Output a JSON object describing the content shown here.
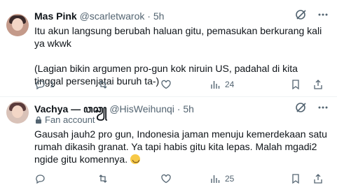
{
  "tweets": [
    {
      "name": "Mas Pink",
      "handle": "@scarletwarok",
      "separator": "·",
      "time": "5h",
      "paragraphs": [
        "Itu akun langsung berubah haluan gitu, pemasukan berkurang kali ya wkwk",
        "(Lagian bikin argumen pro-gun kok niruin US, padahal di kita tinggal persenjatai buruh ta-)"
      ],
      "reply_count": "1",
      "views": "24"
    },
    {
      "name": "Vachya — ꦮꦕꦾ",
      "handle": "@HisWeihunqi",
      "separator": "·",
      "time": "5h",
      "badge": "Fan account",
      "paragraphs": [
        "Gausah jauh2 pro gun, Indonesia jaman menuju kemerdekaan satu rumah dikasih granat. Ya tapi habis gitu kita lepas. Malah mgadi2 ngide gitu komennya."
      ],
      "views": "25"
    }
  ],
  "icons": {
    "grok": "grok-icon",
    "more": "more-icon",
    "reply": "reply-icon",
    "retweet": "retweet-icon",
    "like": "like-icon",
    "views": "views-icon",
    "bookmark": "bookmark-icon",
    "share": "share-icon",
    "badge": "lock-icon"
  },
  "colors": {
    "text": "#0f1419",
    "secondary": "#536471",
    "divider": "#eff3f4"
  }
}
